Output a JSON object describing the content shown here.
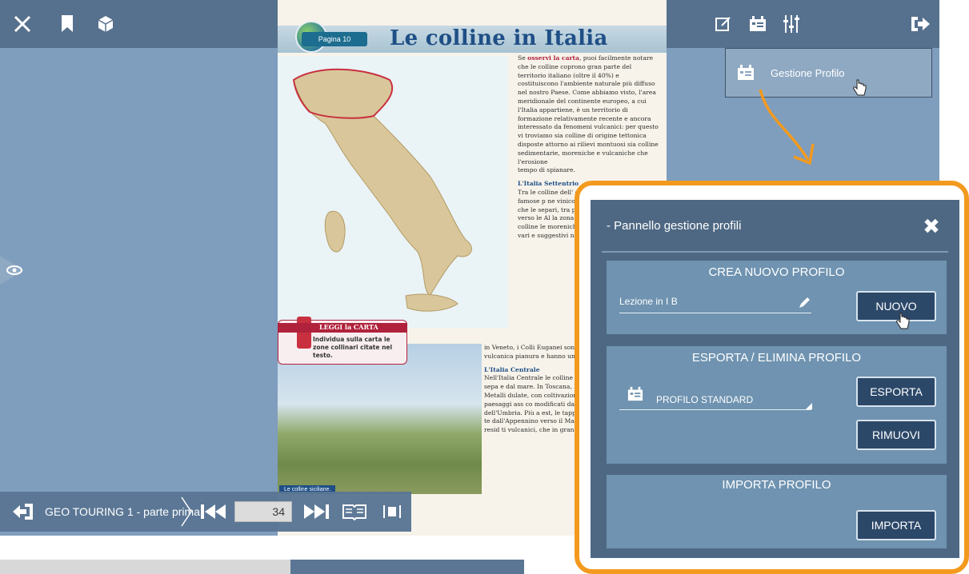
{
  "toolbar_left": {
    "icons": [
      "tools-icon",
      "bookmark-icon",
      "cube-icon"
    ]
  },
  "toolbar_right": {
    "icons": [
      "edit-note-icon",
      "profile-icon",
      "sliders-icon",
      "exit-icon"
    ]
  },
  "profile_menu": {
    "label": "Gestione Profilo"
  },
  "book_page": {
    "badge": "Pagina 10",
    "title": "Le colline in Italia",
    "intro_prefix": "Se ",
    "intro_highlight": "osservi la carta",
    "intro_text": ", puoi facilmente notare che le colline coprono gran parte del territorio italiano (oltre il 40%) e costituiscono l'ambiente naturale più diffuso nel nostro Paese. Come abbiamo visto, l'area meridionale del continente europeo, a cui l'Italia appartiene, è un territorio di formazione relativamente recente e ancora interessato da fenomeni vulcanici: per questo vi troviamo sia colline di origine tettonica disposte attorno ai rilievi montuosi sia colline sedimentarie, moreniche e vulcaniche che l'erosione",
    "intro_tail": "tempo di spianare.",
    "sub1": "L'Italia Settentrio",
    "sub1_text": "Tra le colline dell' quelle delle Lang to sono famose p ne vinicola e i bel no in Piemonte, s che le separi, tra pennini; nella ste nord, verso le Al la zona del Canav trovano le colline le moreniche dell Romagna, fasce c vari e suggestivi no dalla Pianura",
    "leggi_label": "LEGGI la CARTA",
    "leggi_text": "Individua sulla carta le zone collinari citate nel testo.",
    "photo_caption": "Le colline siciliane.",
    "lower_text": "in Veneto, i Colli Euganei son dalla chiara origine vulcanica pianura e hanno una caratteri",
    "sub2": "L'Italia Centrale",
    "sub2_text": "Nell'Italia Centrale le colline no ai sistemi appenninici sepa e dal mare. In Toscana, le colli le senesi e le Colline Metalli dulate, con coltivazioni e inse con l'ambiente; paesaggi ass co modificati dall'uomo caratte line dell'Umbria. Più a est, le tappezzate di campi coltivati, c te dall'Appennino verso il Mar trovano numerosi rilievi, resid ti vulcanici, che in gran parte l"
  },
  "bottom_nav": {
    "back_icon": "back-arrow-icon",
    "book_title": "GEO TOURING 1 - parte prima",
    "page_number": "34",
    "icons": [
      "first-page-icon",
      "last-page-icon",
      "open-book-icon",
      "page-strip-icon"
    ]
  },
  "side_toggle": {
    "icon": "eye-icon"
  },
  "panel": {
    "title": "- Pannello gestione profili",
    "close_icon": "close-icon",
    "create_section": {
      "title": "CREA NUOVO PROFILO",
      "input_value": "Lezione in I B",
      "input_icon": "pencil-icon",
      "button": "NUOVO"
    },
    "export_section": {
      "title": "ESPORTA / ELIMINA PROFILO",
      "profile_icon": "profile-icon",
      "selected_profile": "PROFILO STANDARD",
      "export_button": "ESPORTA",
      "remove_button": "RIMUOVI"
    },
    "import_section": {
      "title": "IMPORTA PROFILO",
      "button": "IMPORTA"
    }
  },
  "colors": {
    "accent_orange": "#f39a1e",
    "panel_bg": "#4e6883",
    "section_bg": "#6f93b0",
    "button_bg": "#2c4869",
    "viewer_bg": "#7f9dbd",
    "title_blue": "#1f4f86",
    "highlight_red": "#b0223b"
  }
}
